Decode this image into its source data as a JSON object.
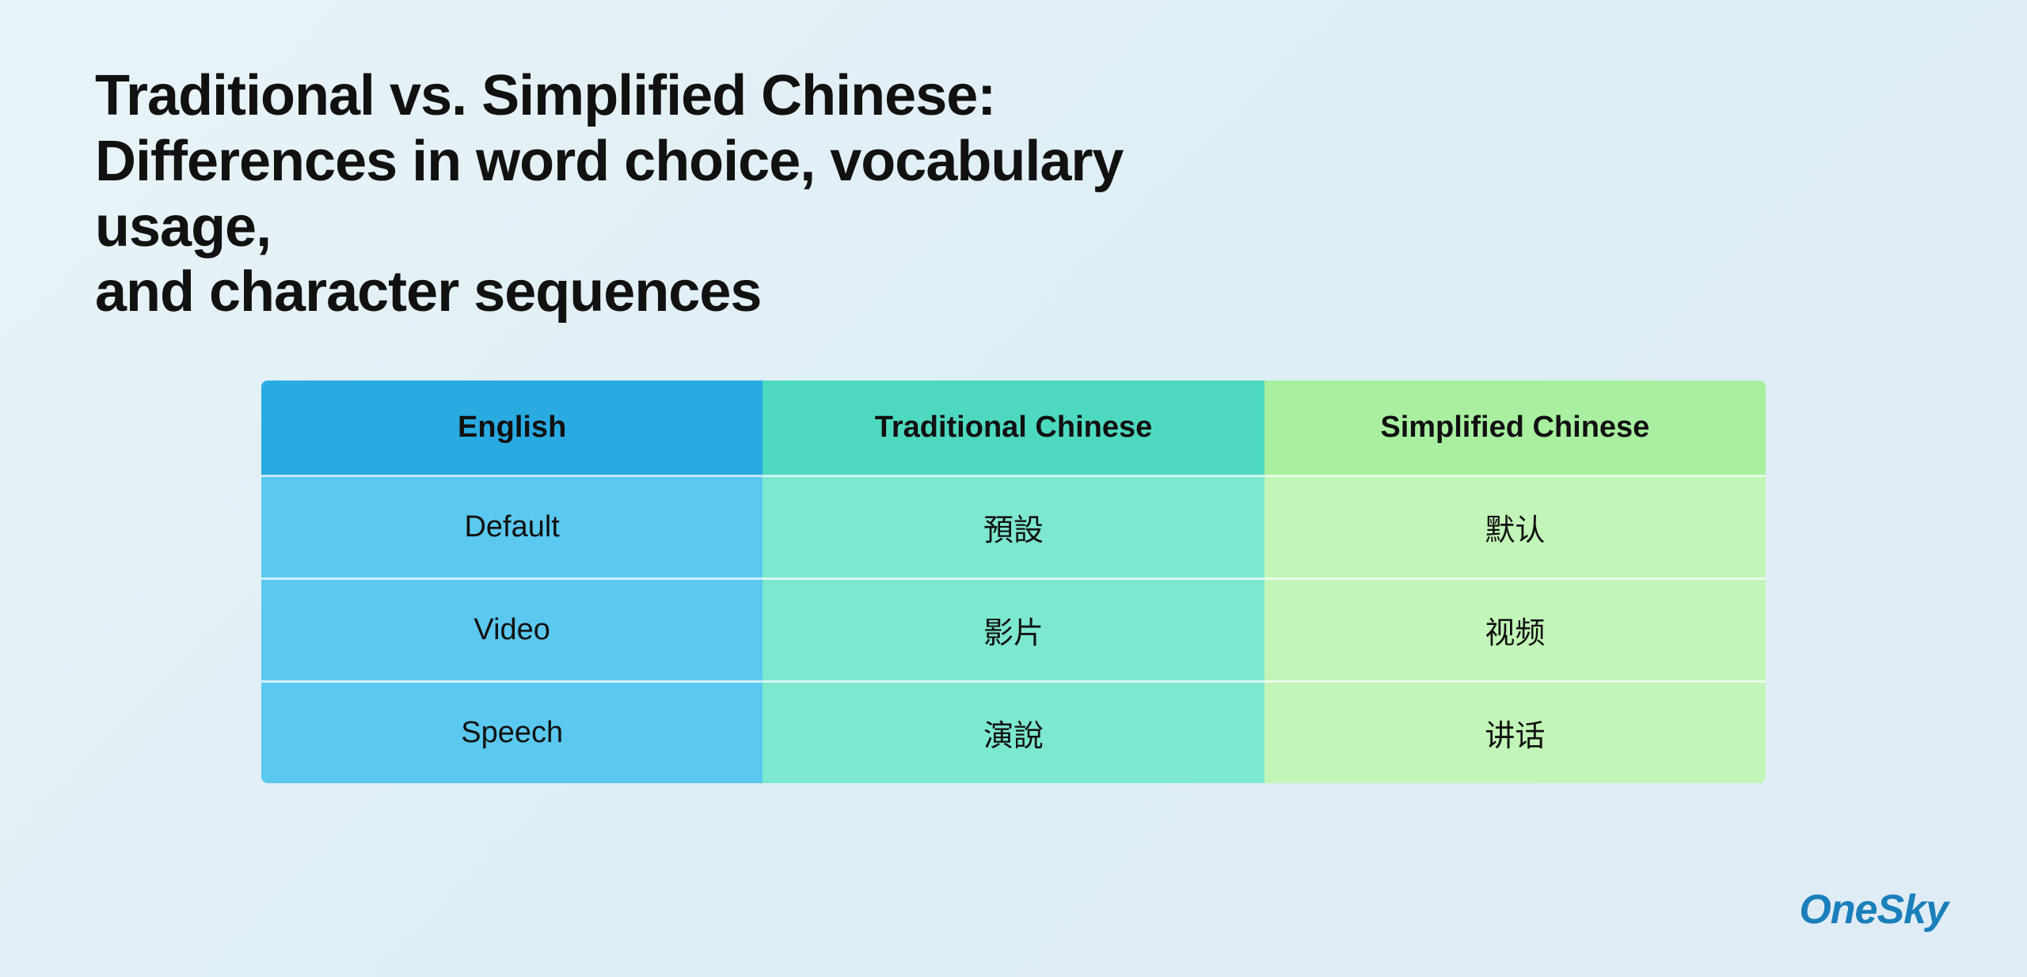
{
  "title": {
    "line1": "Traditional vs. Simplified Chinese:",
    "line2": "Differences in word choice, vocabulary usage,",
    "line3": "and character sequences"
  },
  "table": {
    "headers": {
      "english": "English",
      "traditional": "Traditional Chinese",
      "simplified": "Simplified Chinese"
    },
    "rows": [
      {
        "english": "Default",
        "traditional": "預設",
        "simplified": "默认"
      },
      {
        "english": "Video",
        "traditional": "影片",
        "simplified": "视频"
      },
      {
        "english": "Speech",
        "traditional": "演說",
        "simplified": "讲话"
      }
    ]
  },
  "logo": {
    "text": "OneSky"
  }
}
